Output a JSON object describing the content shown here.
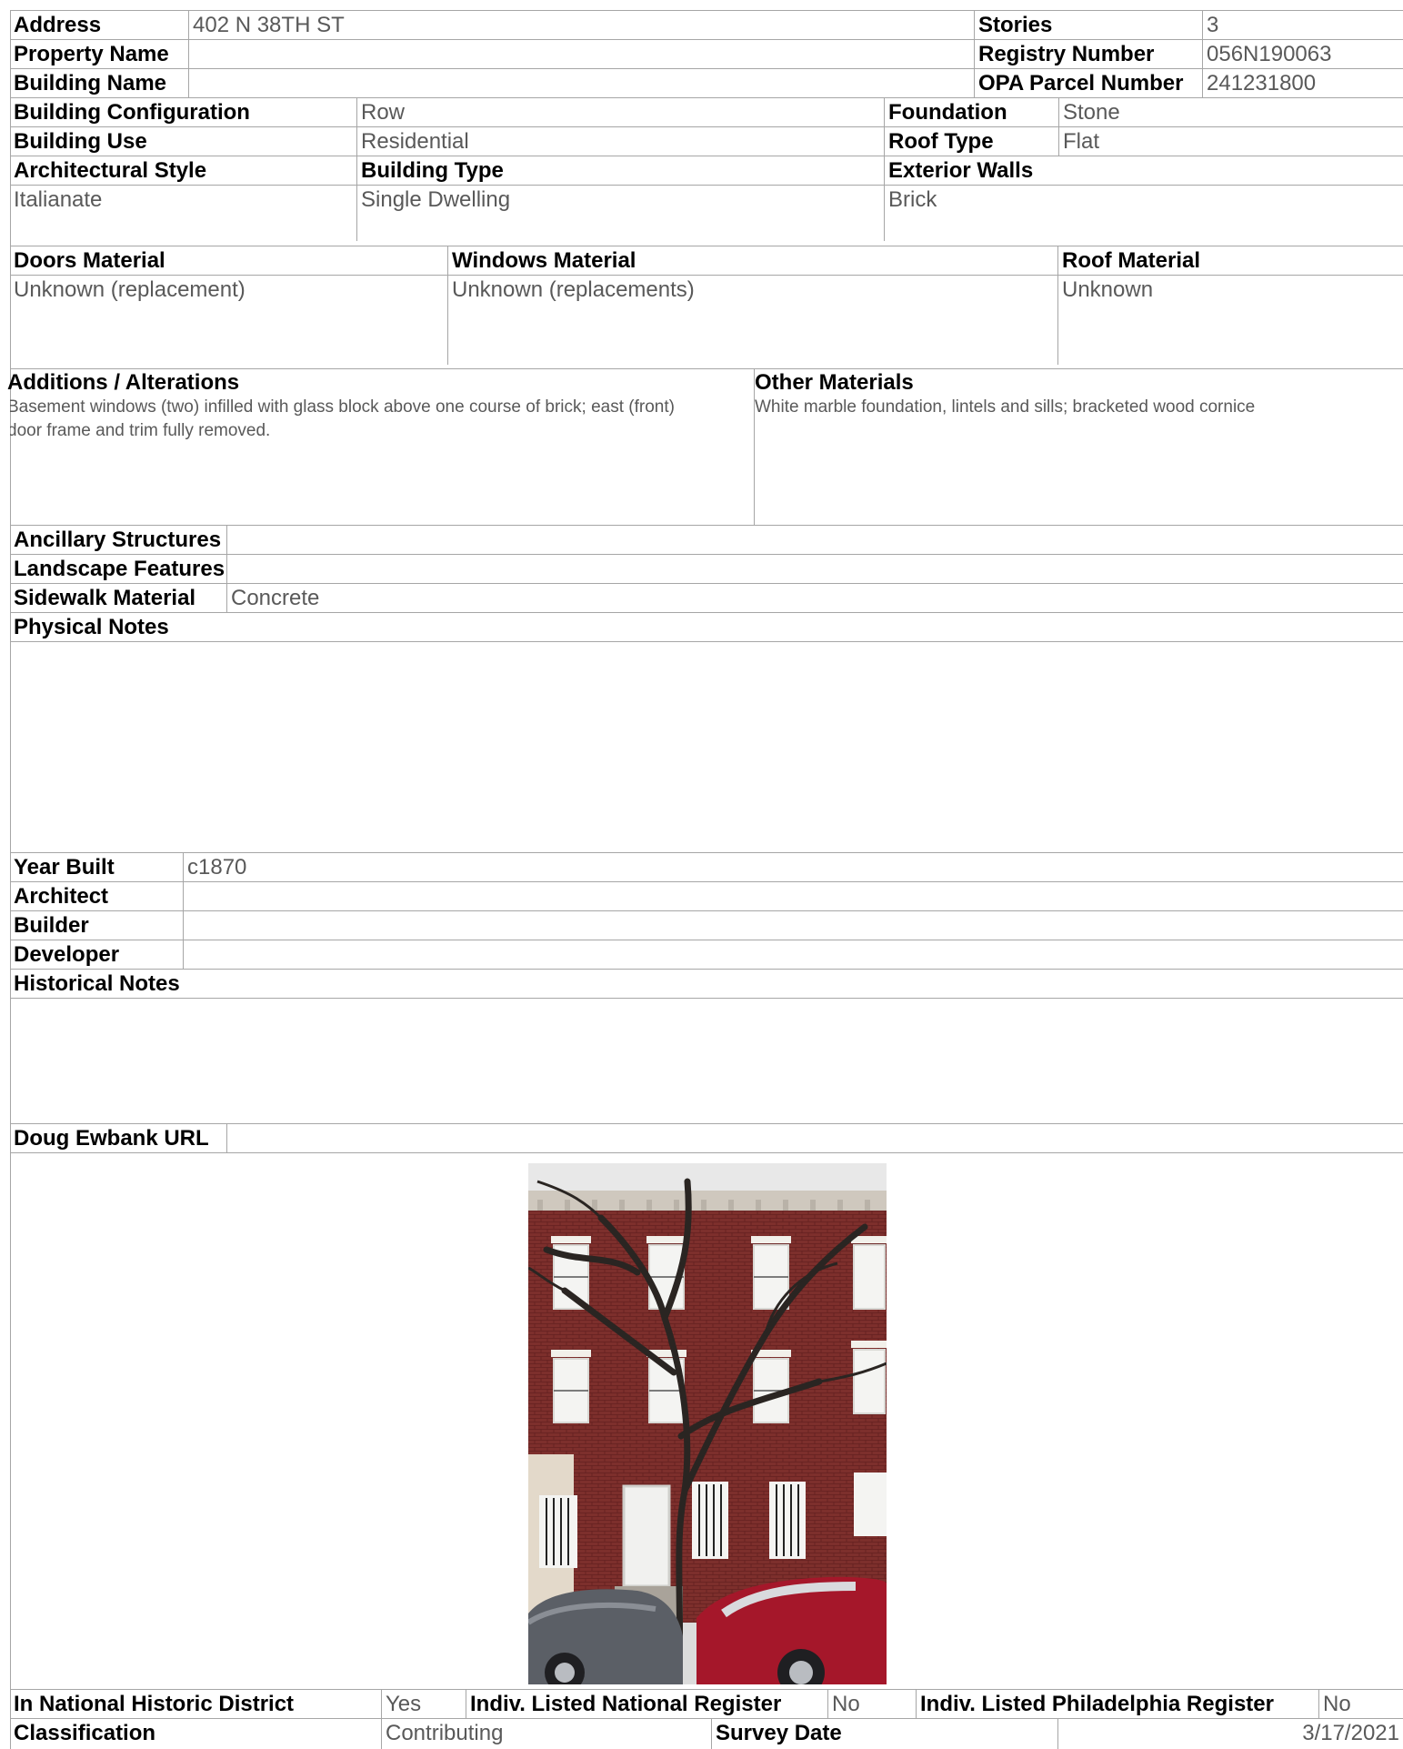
{
  "header": {
    "address": {
      "label": "Address",
      "value": "402 N 38TH ST"
    },
    "stories": {
      "label": "Stories",
      "value": "3"
    },
    "property_name": {
      "label": "Property Name",
      "value": ""
    },
    "registry_number": {
      "label": "Registry Number",
      "value": "056N190063"
    },
    "building_name": {
      "label": "Building Name",
      "value": ""
    },
    "opa_parcel_number": {
      "label": "OPA Parcel Number",
      "value": "241231800"
    }
  },
  "building": {
    "configuration": {
      "label": "Building Configuration",
      "value": "Row"
    },
    "foundation": {
      "label": "Foundation",
      "value": "Stone"
    },
    "use": {
      "label": "Building Use",
      "value": "Residential"
    },
    "roof_type": {
      "label": "Roof Type",
      "value": "Flat"
    },
    "architectural_style": {
      "label": "Architectural Style",
      "value": "Italianate"
    },
    "building_type": {
      "label": "Building Type",
      "value": "Single Dwelling"
    },
    "exterior_walls": {
      "label": "Exterior Walls",
      "value": "Brick"
    }
  },
  "materials": {
    "doors": {
      "label": "Doors Material",
      "value": "Unknown (replacement)"
    },
    "windows": {
      "label": "Windows Material",
      "value": "Unknown (replacements)"
    },
    "roof": {
      "label": "Roof Material",
      "value": "Unknown"
    }
  },
  "alterations": {
    "label": "Additions / Alterations",
    "value": "Basement windows (two) infilled with glass block above one course of brick; east (front) door frame and trim fully removed."
  },
  "other_materials": {
    "label": "Other Materials",
    "value": "White marble foundation, lintels and sills; bracketed wood cornice"
  },
  "site": {
    "ancillary_structures": {
      "label": "Ancillary Structures",
      "value": ""
    },
    "landscape_features": {
      "label": "Landscape Features",
      "value": ""
    },
    "sidewalk_material": {
      "label": "Sidewalk Material",
      "value": "Concrete"
    }
  },
  "physical_notes": {
    "label": "Physical Notes",
    "value": ""
  },
  "history": {
    "year_built": {
      "label": "Year Built",
      "value": "c1870"
    },
    "architect": {
      "label": "Architect",
      "value": ""
    },
    "builder": {
      "label": "Builder",
      "value": ""
    },
    "developer": {
      "label": "Developer",
      "value": ""
    }
  },
  "historical_notes": {
    "label": "Historical Notes",
    "value": ""
  },
  "doug_ewbank_url": {
    "label": "Doug Ewbank URL",
    "value": ""
  },
  "status": {
    "national_district": {
      "label": "In National Historic District",
      "value": "Yes"
    },
    "national_register": {
      "label": "Indiv. Listed National Register",
      "value": "No"
    },
    "philadelphia_register": {
      "label": "Indiv. Listed Philadelphia Register",
      "value": "No"
    },
    "classification": {
      "label": "Classification",
      "value": "Contributing"
    },
    "survey_date": {
      "label": "Survey Date",
      "value": "3/17/2021"
    }
  }
}
